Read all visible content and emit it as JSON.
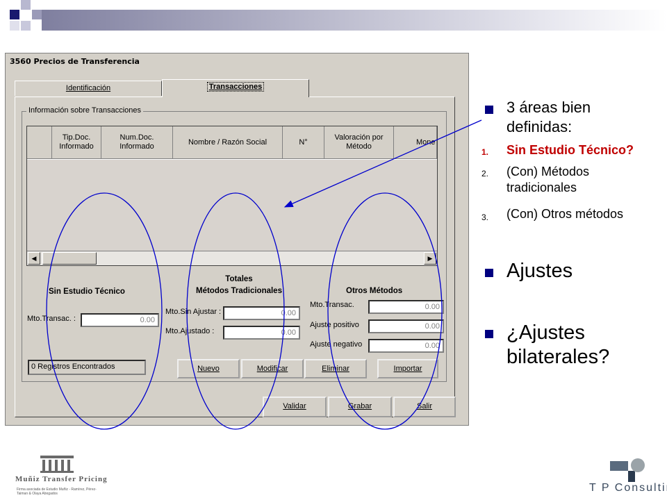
{
  "window": {
    "title": "3560 Precios de Transferencia",
    "tabs": [
      {
        "label": "Identificación",
        "active": false
      },
      {
        "label": "Transacciones",
        "active": true
      }
    ],
    "group_title": "Información sobre Transacciones",
    "grid": {
      "columns": [
        "",
        "Tip.Doc. Informado",
        "Num.Doc. Informado",
        "Nombre / Razón Social",
        "N°",
        "Valoración por Método",
        "Mone"
      ]
    },
    "sections": {
      "sin_estudio": {
        "title": "Sin Estudio Técnico",
        "label": "Mto.Transac. :",
        "value": "0.00"
      },
      "totales": {
        "heading": "Totales",
        "title": "Métodos Tradicionales",
        "fields": [
          {
            "label": "Mto.Sin Ajustar :",
            "value": "0.00"
          },
          {
            "label": "Mto.Ajustado    :",
            "value": "0.00"
          }
        ]
      },
      "otros": {
        "title": "Otros Métodos",
        "fields": [
          {
            "label": "Mto.Transac.",
            "value": "0.00"
          },
          {
            "label": "Ajuste positivo",
            "value": "0.00"
          },
          {
            "label": "Ajuste negativo",
            "value": "0.00"
          }
        ]
      }
    },
    "status": "0 Registros Encontrados",
    "buttons": [
      "Nuevo",
      "Modificar",
      "Eliminar",
      "Importar"
    ],
    "bottom_buttons": [
      "Validar",
      "Grabar",
      "Salir"
    ]
  },
  "bullets": {
    "main": [
      {
        "text": "3 áreas bien definidas:"
      },
      {
        "text": "Ajustes"
      },
      {
        "text": "¿Ajustes bilaterales?"
      }
    ],
    "numbered": [
      {
        "n": "1.",
        "text": "Sin Estudio Técnico?",
        "color": "#c00000"
      },
      {
        "n": "2.",
        "text": "(Con) Métodos tradicionales",
        "color": "#000000"
      },
      {
        "n": "3.",
        "text": "(Con) Otros métodos",
        "color": "#000000"
      }
    ]
  },
  "logos": {
    "left": {
      "name": "Muñiz Transfer Pricing",
      "sub": "Firma asociada de Estudio Muñiz - Ramírez, Pérez-Taiman & Olaya Abogados"
    },
    "right": {
      "name": "T P Consulting"
    }
  },
  "colors": {
    "accent": "#000080",
    "highlight": "#c00000",
    "annotation": "#0000cc"
  }
}
